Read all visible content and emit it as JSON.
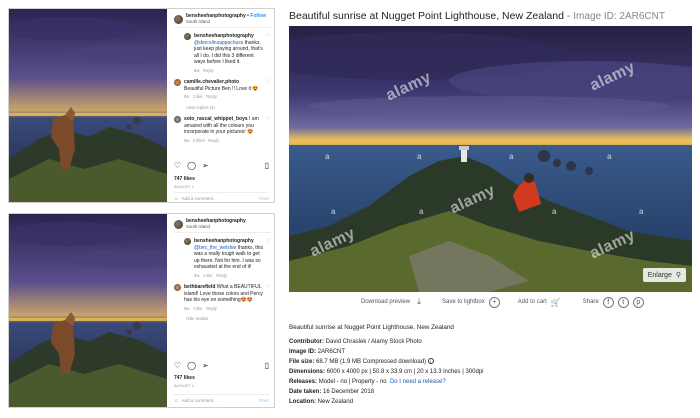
{
  "instagram_top": {
    "username": "bensheehanphotography",
    "follow": "Follow",
    "location": "South Island",
    "comments": [
      {
        "user": "bensheehanphotography",
        "mention": "@dercolinsappachuss",
        "text": "thanks, just keep playing around, that's all I do. I did this 3 different ways before I liked it.",
        "age": "6w",
        "likes": "",
        "reply": "Reply"
      },
      {
        "user": "camille.chevalier.photo",
        "mention": "",
        "text": "Beautiful Picture Ben !! Love it 😍",
        "age": "6w",
        "likes": "1 like",
        "reply": "Reply"
      },
      {
        "user": "solo_rascal_whippet_boys",
        "mention": "",
        "text": "I am amazed with all the colours you incorporate in your pictures! 😍",
        "age": "6w",
        "likes": "2 likes",
        "reply": "Reply"
      }
    ],
    "view_replies": "View replies (4)",
    "likes": "747 likes",
    "date": "AUGUST 1",
    "add_comment": "Add a comment...",
    "post": "Post"
  },
  "instagram_bottom": {
    "username": "bensheehanphotography",
    "location": "South Island",
    "comments": [
      {
        "user": "bensheehanphotography",
        "mention": "@bec_the_welshie",
        "text": "thanks, this was a really tough walk to get up there. Not for him. I was so exhausted at the end of it!",
        "age": "5w",
        "likes": "1 like",
        "reply": "Reply"
      },
      {
        "user": "bethbarefield",
        "mention": "",
        "text": "What a BEAUTIFUL island! Love those colors and Percy has his eye on something😍😍",
        "age": "6w",
        "likes": "1 like",
        "reply": "Reply"
      }
    ],
    "hide_replies": "Hide replies",
    "likes": "747 likes",
    "date": "AUGUST 1",
    "add_comment": "Add a comment...",
    "post": "Post"
  },
  "main": {
    "title": "Beautiful sunrise at Nugget Point Lighthouse, New Zealand",
    "separator": "-",
    "image_id_label": "Image ID: 2AR6CNT",
    "watermark": "alamy",
    "watermark_small": "a",
    "enlarge": "Enlarge"
  },
  "toolbar": {
    "download_preview": "Download preview",
    "save_to_lightbox": "Save to lightbox",
    "add_to_cart": "Add to cart",
    "share": "Share"
  },
  "details": {
    "caption": "Beautiful sunrise at Nugget Point Lighthouse, New Zealand",
    "contributor_label": "Contributor:",
    "contributor": "David Chraslek / Alamy Stock Photo",
    "image_id_label": "Image ID:",
    "image_id": "2AR6CNT",
    "file_size_label": "File size:",
    "file_size": "68.7 MB (1.9 MB Compressed download)",
    "dimensions_label": "Dimensions:",
    "dimensions": "6000 x 4000 px | 50.8 x 33.9 cm | 20 x 13.3 inches | 300dpi",
    "releases_label": "Releases:",
    "releases": "Model - no | Property - no",
    "release_link": "Do I need a release?",
    "date_label": "Date taken:",
    "date": "16 December 2018",
    "location_label": "Location:",
    "location": "New Zealand"
  },
  "colors": {
    "link": "#1a5fb4",
    "follow": "#3897f0",
    "sky_dark": "#2a2450",
    "sunrise": "#f2c14e"
  }
}
